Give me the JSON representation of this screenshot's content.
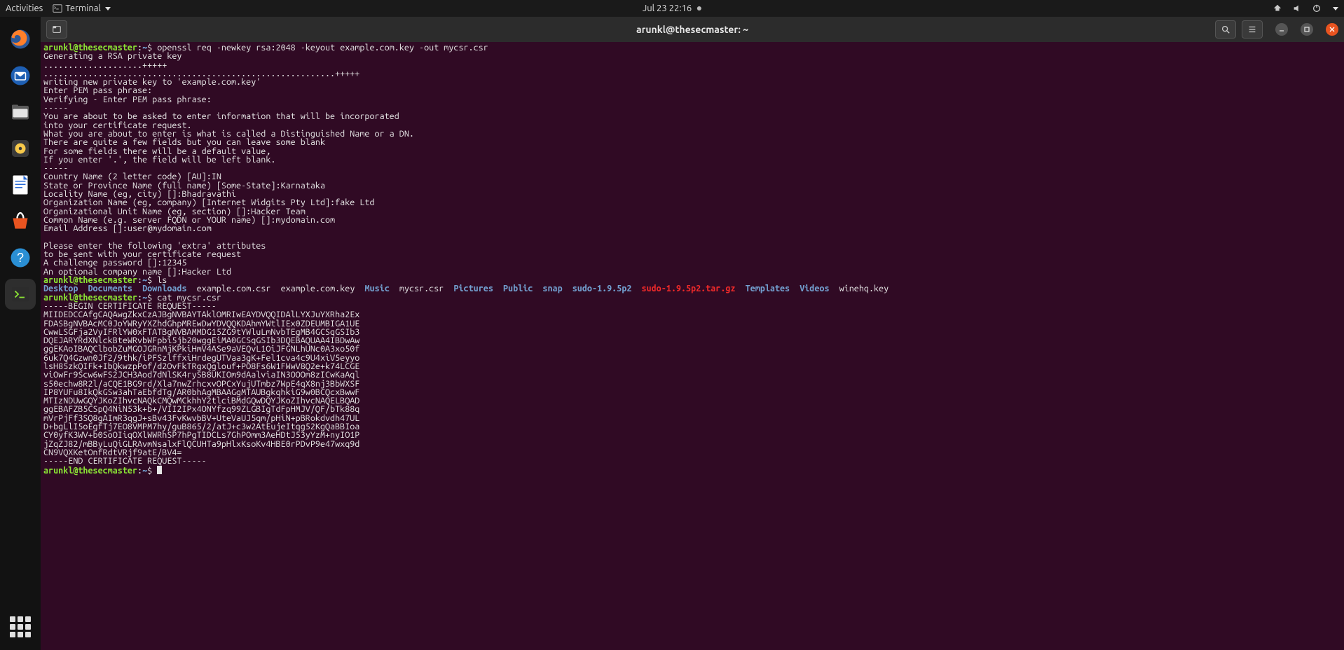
{
  "topbar": {
    "activities": "Activities",
    "app_name": "Terminal",
    "datetime": "Jul 23  22:16"
  },
  "dock": {
    "items": [
      {
        "name": "firefox"
      },
      {
        "name": "thunderbird"
      },
      {
        "name": "files"
      },
      {
        "name": "rhythmbox"
      },
      {
        "name": "libreoffice-writer"
      },
      {
        "name": "ubuntu-software"
      },
      {
        "name": "help"
      },
      {
        "name": "terminal"
      }
    ]
  },
  "window": {
    "title": "arunkl@thesecmaster: ~"
  },
  "prompt": {
    "user": "arunkl@thesecmaster",
    "path": "~",
    "sep": ":",
    "dollar": "$"
  },
  "commands": {
    "c1": "openssl req -newkey rsa:2048 -keyout example.com.key -out mycsr.csr",
    "c2": "ls",
    "c3": "cat mycsr.csr"
  },
  "output": {
    "o1": "Generating a RSA private key",
    "o2": "....................+++++",
    "o3": "...........................................................+++++",
    "o4": "writing new private key to 'example.com.key'",
    "o5": "Enter PEM pass phrase:",
    "o6": "Verifying - Enter PEM pass phrase:",
    "o7": "-----",
    "o8": "You are about to be asked to enter information that will be incorporated",
    "o9": "into your certificate request.",
    "o10": "What you are about to enter is what is called a Distinguished Name or a DN.",
    "o11": "There are quite a few fields but you can leave some blank",
    "o12": "For some fields there will be a default value,",
    "o13": "If you enter '.', the field will be left blank.",
    "o14": "-----",
    "o15": "Country Name (2 letter code) [AU]:IN",
    "o16": "State or Province Name (full name) [Some-State]:Karnataka",
    "o17": "Locality Name (eg, city) []:Bhadravathi",
    "o18": "Organization Name (eg, company) [Internet Widgits Pty Ltd]:fake Ltd",
    "o19": "Organizational Unit Name (eg, section) []:Hacker Team",
    "o20": "Common Name (e.g. server FQDN or YOUR name) []:mydomain.com",
    "o21": "Email Address []:user@mydomain.com",
    "o22": "",
    "o23": "Please enter the following 'extra' attributes",
    "o24": "to be sent with your certificate request",
    "o25": "A challenge password []:12345",
    "o26": "An optional company name []:Hacker Ltd"
  },
  "ls": {
    "dirs": [
      "Desktop",
      "Documents",
      "Downloads"
    ],
    "f1": "example.com.csr",
    "f2": "example.com.key",
    "dir_music": "Music",
    "f3": "mycsr.csr",
    "dirs2": [
      "Pictures",
      "Public",
      "snap",
      "sudo-1.9.5p2"
    ],
    "arc": "sudo-1.9.5p2.tar.gz",
    "dirs3": [
      "Templates",
      "Videos"
    ],
    "f4": "winehq.key"
  },
  "csr": {
    "l1": "-----BEGIN CERTIFICATE REQUEST-----",
    "l2": "MIIDEDCCAfgCAQAwgZkxCzAJBgNVBAYTAklOMRIwEAYDVQQIDAlLYXJuYXRha2Ex",
    "l3": "FDASBgNVBAcMC0JoYWRyYXZhdGhpMREwDwYDVQQKDAhmYWtlIEx0ZDEUMBIGA1UE",
    "l4": "CwwLSGFja2VyIFRlYW0xFTATBgNVBAMMDG15ZG9tYWluLmNvbTEgMB4GCSqGSIb3",
    "l5": "DQEJARYRdXNlckBteWRvbWFpbi5jb20wggEiMA0GCSqGSIb3DQEBAQUAA4IBDwAw",
    "l6": "ggEKAoIBAQClbobZuMGOJGRnMjKPkiHmV4ASe9aVEQvL1OiJFGNLhUNc0A3xo50f",
    "l7": "6uk7Q4Gzwn0Jf2/9thk/iPFSzlffxiHrdegUTVaa3gK+Fel1cva4c9U4xiV5eyyo",
    "l8": "lsH85zkQIFk+IbQkwzpPof/d2OvFkTRgxQglouf+PO8Fs6W1FWwV8Q2e+k74LCGE",
    "l9": "viOwFr9Scw6wFS2JCH3Aod7dNlSK4rySB8UKIOm9dAalviaIN3OOOm8zICwKaAql",
    "l10": "s50echw8R2l/aCQE1BG9rd/Xla7nwZrhcxvOPCxYujUTmbz7WpE4qX8nj3BbWXSF",
    "l11": "IP8YUFu8IkQkGSw3ahTaEbfdTg/AR0bhAgMBAAGgMTAUBgkqhkiG9w0BCQcxBwwF",
    "l12": "MTIzNDUwGQYJKoZIhvcNAQkCMQwMCkhhY2tlciBMdGQwDQYJKoZIhvcNAQELBQAD",
    "l13": "ggEBAFZB5CSpQ4NiN53k+b+/VII2IPx4ONYfzq99ZLGBIgTdFpHMJV/QF/bTk88q",
    "l14": "mVrPjFf3SQ8gAImR3qgJ+sBv43FvKwvbBV+UteVaUJ5qm/pHiN+pBRokdvdh47UL",
    "l15": "D+bgLlI5oEgfTj7EO8VMPM7hy/guB865/2/atJ+c3w2AtEujeItqg52KgQaBBIoa",
    "l16": "CY0yfK3WV+b0SoOIiqOXlWWRhSP7hPgTIDCLs7GhPOmm3AeHDtJ53yYzM+nyIO1P",
    "l17": "jZqZJ82/mBByLuQiGLRAvmNsalxFlQCUHTa9pHlxKsoKv4HBE0rPDvP9e47wxq9d",
    "l18": "CN9VQXKetOnfRdtVRjf9atE/BV4=",
    "l19": "-----END CERTIFICATE REQUEST-----"
  }
}
